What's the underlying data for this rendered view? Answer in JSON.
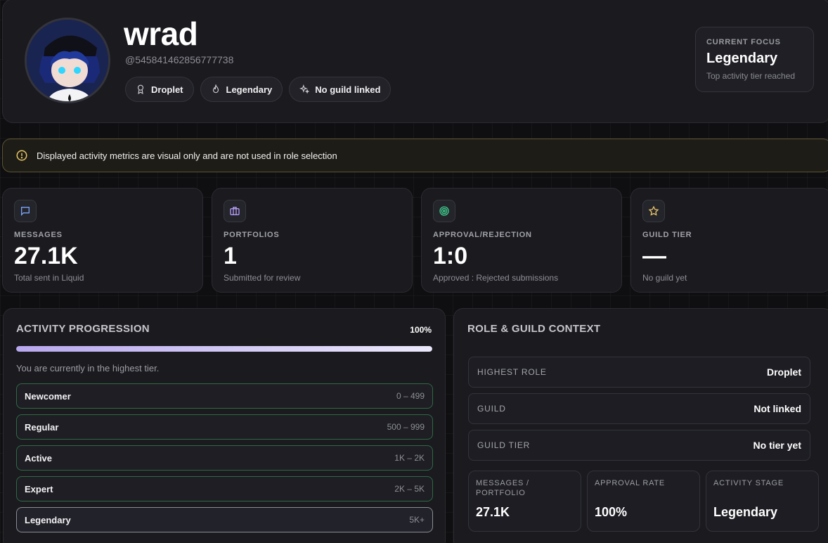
{
  "profile": {
    "username": "wrad",
    "user_id": "@545841462856777738",
    "badges": [
      {
        "label": "Droplet",
        "icon": "award-icon"
      },
      {
        "label": "Legendary",
        "icon": "flame-icon"
      },
      {
        "label": "No guild linked",
        "icon": "sparkles-icon"
      }
    ],
    "focus": {
      "label": "CURRENT FOCUS",
      "value": "Legendary",
      "sub": "Top activity tier reached"
    }
  },
  "warning": {
    "icon": "alert-circle-icon",
    "text": "Displayed activity metrics are visual only and are not used in role selection"
  },
  "stats": [
    {
      "label": "MESSAGES",
      "value": "27.1K",
      "sub": "Total sent in Liquid",
      "icon": "message-square-icon",
      "color": "#7aa2f7"
    },
    {
      "label": "PORTFOLIOS",
      "value": "1",
      "sub": "Submitted for review",
      "icon": "briefcase-icon",
      "color": "#b39df5"
    },
    {
      "label": "APPROVAL/REJECTION",
      "value": "1:0",
      "sub": "Approved : Rejected submissions",
      "icon": "target-icon",
      "color": "#3ecf8e"
    },
    {
      "label": "GUILD TIER",
      "value": "—",
      "sub": "No guild yet",
      "icon": "star-icon",
      "color": "#e8c46a"
    }
  ],
  "progression": {
    "title": "ACTIVITY PROGRESSION",
    "percent_label": "100%",
    "percent": 100,
    "hint": "You are currently in the highest tier.",
    "tiers": [
      {
        "name": "Newcomer",
        "range": "0 – 499"
      },
      {
        "name": "Regular",
        "range": "500 – 999"
      },
      {
        "name": "Active",
        "range": "1K – 2K"
      },
      {
        "name": "Expert",
        "range": "2K – 5K"
      },
      {
        "name": "Legendary",
        "range": "5K+"
      }
    ]
  },
  "context": {
    "title": "ROLE & GUILD CONTEXT",
    "rows": [
      {
        "label": "HIGHEST ROLE",
        "value": "Droplet"
      },
      {
        "label": "GUILD",
        "value": "Not linked"
      },
      {
        "label": "GUILD TIER",
        "value": "No tier yet"
      }
    ],
    "minis": [
      {
        "label": "MESSAGES / PORTFOLIO",
        "value": "27.1K"
      },
      {
        "label": "APPROVAL RATE",
        "value": "100%"
      },
      {
        "label": "ACTIVITY STAGE",
        "value": "Legendary"
      }
    ]
  }
}
